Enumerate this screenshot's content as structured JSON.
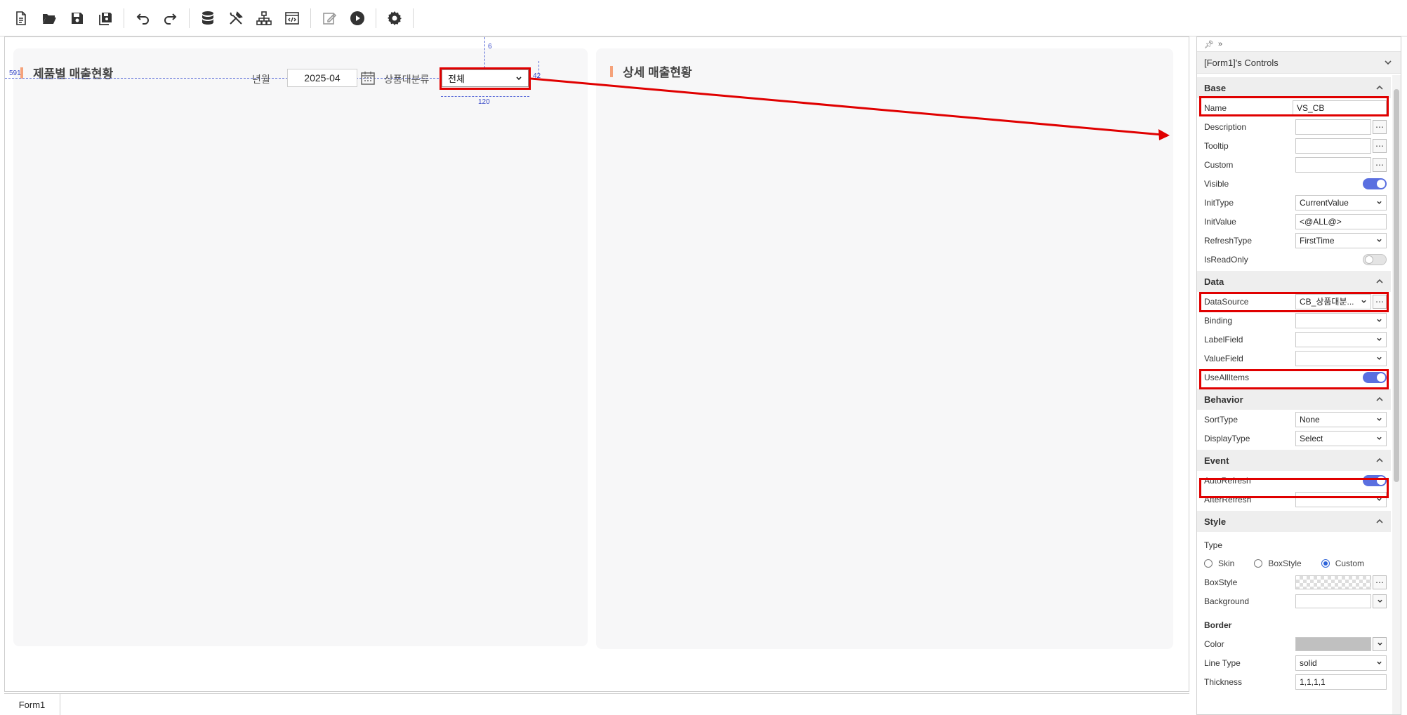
{
  "toolbar": {
    "buttons": [
      {
        "name": "new-file",
        "icon": "new-file-icon"
      },
      {
        "name": "open-folder",
        "icon": "folder-open-icon"
      },
      {
        "name": "save",
        "icon": "save-icon"
      },
      {
        "name": "save-all",
        "icon": "save-all-icon"
      },
      {
        "name": "undo",
        "icon": "undo-icon"
      },
      {
        "name": "redo",
        "icon": "redo-icon"
      },
      {
        "name": "database",
        "icon": "database-icon"
      },
      {
        "name": "tools",
        "icon": "tools-icon"
      },
      {
        "name": "hierarchy",
        "icon": "hierarchy-icon"
      },
      {
        "name": "code-view",
        "icon": "code-view-icon"
      },
      {
        "name": "edit",
        "icon": "edit-icon"
      },
      {
        "name": "run",
        "icon": "play-icon"
      },
      {
        "name": "settings",
        "icon": "gear-icon"
      }
    ]
  },
  "canvas": {
    "left_panel_title": "제품별 매출현황",
    "right_panel_title": "상세 매출현황",
    "filter_year_month_label": "년월",
    "filter_year_month_value": "2025-04",
    "filter_category_label": "상품대분류",
    "filter_category_value": "전체",
    "guide_left_value": "591",
    "guide_top_value": "6",
    "guide_width_value": "120",
    "guide_height_value": "42"
  },
  "bottom_tabs": [
    "Form1"
  ],
  "props": {
    "header": "[Form1]'s Controls",
    "sections": {
      "base": "Base",
      "data": "Data",
      "behavior": "Behavior",
      "event": "Event",
      "style": "Style"
    },
    "base": {
      "name_label": "Name",
      "name_value": "VS_CB",
      "description_label": "Description",
      "tooltip_label": "Tooltip",
      "custom_label": "Custom",
      "visible_label": "Visible",
      "inittype_label": "InitType",
      "inittype_value": "CurrentValue",
      "initvalue_label": "InitValue",
      "initvalue_value": "<@ALL@>",
      "refreshtype_label": "RefreshType",
      "refreshtype_value": "FirstTime",
      "isreadonly_label": "IsReadOnly"
    },
    "data": {
      "datasource_label": "DataSource",
      "datasource_value": "CB_상품대분...",
      "binding_label": "Binding",
      "labelfield_label": "LabelField",
      "valuefield_label": "ValueField",
      "useallitems_label": "UseAllItems"
    },
    "behavior": {
      "sorttype_label": "SortType",
      "sorttype_value": "None",
      "displaytype_label": "DisplayType",
      "displaytype_value": "Select"
    },
    "event": {
      "autorefresh_label": "AutoRefresh",
      "afterrefresh_label": "AfterRefresh"
    },
    "style": {
      "type_label": "Type",
      "radio_skin": "Skin",
      "radio_boxstyle": "BoxStyle",
      "radio_custom": "Custom",
      "boxstyle_label": "BoxStyle",
      "background_label": "Background",
      "border_label": "Border",
      "color_label": "Color",
      "linetype_label": "Line Type",
      "linetype_value": "solid",
      "thickness_label": "Thickness",
      "thickness_value": "1,1,1,1"
    },
    "toggles": {
      "visible": true,
      "isreadonly": false,
      "useallitems": true,
      "autorefresh": true
    },
    "accent_color": "#5a6fe0",
    "highlight_color": "#e00000"
  }
}
